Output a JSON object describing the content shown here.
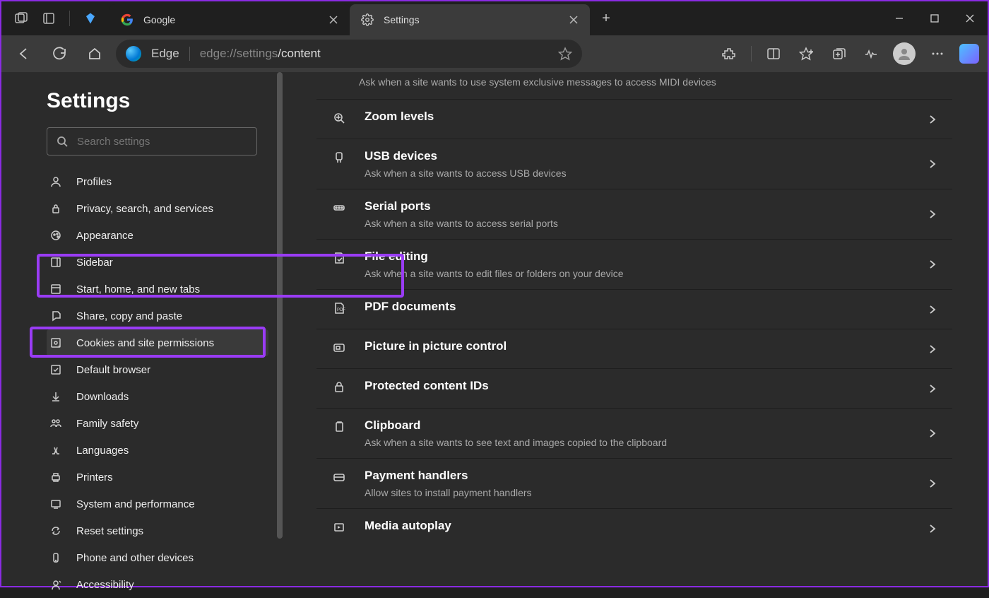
{
  "titlebar": {
    "tabs": [
      {
        "title": "Google",
        "active": false
      },
      {
        "title": "Settings",
        "active": true
      }
    ]
  },
  "toolbar": {
    "edge_label": "Edge",
    "url_prefix": "edge://settings",
    "url_suffix": "/content"
  },
  "sidebar": {
    "heading": "Settings",
    "search_placeholder": "Search settings",
    "items": [
      "Profiles",
      "Privacy, search, and services",
      "Appearance",
      "Sidebar",
      "Start, home, and new tabs",
      "Share, copy and paste",
      "Cookies and site permissions",
      "Default browser",
      "Downloads",
      "Family safety",
      "Languages",
      "Printers",
      "System and performance",
      "Reset settings",
      "Phone and other devices",
      "Accessibility"
    ],
    "active_index": 6
  },
  "main": {
    "top_desc": "Ask when a site wants to use system exclusive messages to access MIDI devices",
    "rows": [
      {
        "title": "Zoom levels",
        "sub": ""
      },
      {
        "title": "USB devices",
        "sub": "Ask when a site wants to access USB devices"
      },
      {
        "title": "Serial ports",
        "sub": "Ask when a site wants to access serial ports"
      },
      {
        "title": "File editing",
        "sub": "Ask when a site wants to edit files or folders on your device"
      },
      {
        "title": "PDF documents",
        "sub": ""
      },
      {
        "title": "Picture in picture control",
        "sub": ""
      },
      {
        "title": "Protected content IDs",
        "sub": ""
      },
      {
        "title": "Clipboard",
        "sub": "Ask when a site wants to see text and images copied to the clipboard"
      },
      {
        "title": "Payment handlers",
        "sub": "Allow sites to install payment handlers"
      },
      {
        "title": "Media autoplay",
        "sub": ""
      }
    ],
    "highlight_index": 5
  }
}
